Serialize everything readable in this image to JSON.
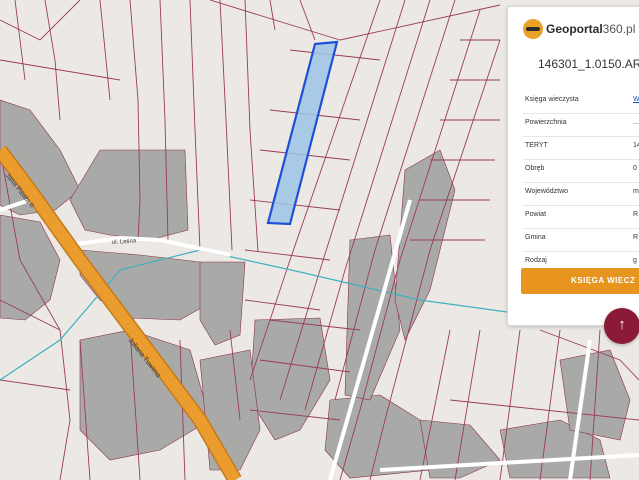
{
  "map": {
    "road_labels": [
      "Jana Pawła II",
      "Juliana Tuwima",
      "ul. Leśna"
    ],
    "colors": {
      "background": "#ece9e4",
      "parcel_line": "#9a3a5c",
      "building": "#a9aaa8",
      "road": "#ea9c2e",
      "highlight_fill": "#9ec4e6",
      "highlight_stroke": "#1f4fd6",
      "stream": "#3fb0c0"
    }
  },
  "panel": {
    "brand": {
      "name": "Geoportal",
      "version": "360.pl"
    },
    "parcel_id": "146301_1.0150.AR",
    "rows": [
      {
        "label": "Księga wieczysta",
        "value": "W"
      },
      {
        "label": "Powierzchnia",
        "value": "..."
      },
      {
        "label": "TERYT",
        "value": "14"
      },
      {
        "label": "Obręb",
        "value": "0"
      },
      {
        "label": "Województwo",
        "value": "m"
      },
      {
        "label": "Powiat",
        "value": "R"
      },
      {
        "label": "Gmina",
        "value": "R"
      },
      {
        "label": "Rodzaj",
        "value": "g"
      }
    ],
    "action_label": "KSIĘGA WIECZ"
  },
  "fab": {
    "icon": "arrow-up-icon",
    "symbol": "↑"
  }
}
